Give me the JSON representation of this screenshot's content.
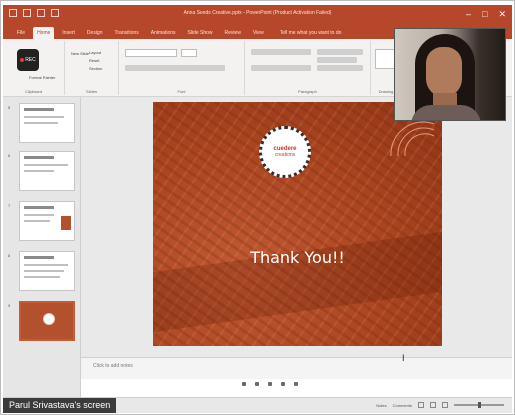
{
  "app": {
    "document_title": "Anna Seeds Creative.pptx - PowerPoint (Product Activation Failed)",
    "window_controls": [
      "–",
      "□",
      "✕"
    ]
  },
  "ribbon": {
    "tabs": [
      "File",
      "Home",
      "Insert",
      "Design",
      "Transitions",
      "Animations",
      "Slide Show",
      "Review",
      "View"
    ],
    "active_tab": "Home",
    "tell_me": "Tell me what you want to do",
    "rec_label": "REC",
    "paste_label": "Format Painter",
    "new_slide_label": "New Slide",
    "slide_buttons": [
      "Layout",
      "Reset",
      "Section"
    ],
    "group_labels": [
      "Clipboard",
      "Slides",
      "Font",
      "Paragraph",
      "Drawing"
    ]
  },
  "slide": {
    "logo_line1": "cuedere",
    "logo_line2": "creations",
    "thanks_text": "Thank You!!"
  },
  "notes": {
    "placeholder": "Click to add notes"
  },
  "statusbar": {
    "notes_label": "Notes",
    "comments_label": "Comments"
  },
  "share": {
    "label": "Parul Srivastava's screen"
  },
  "colors": {
    "accent": "#b7472a",
    "slide_bg": "#a9441f"
  }
}
